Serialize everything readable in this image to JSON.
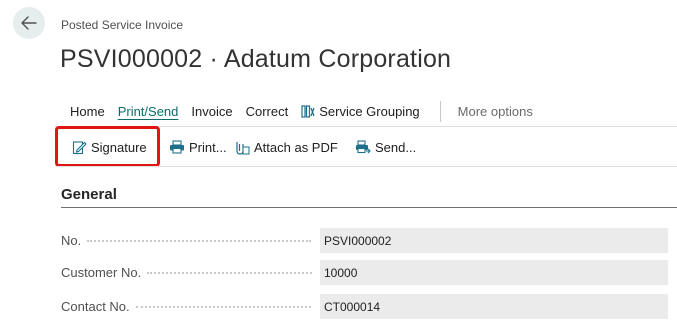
{
  "page": {
    "caption": "Posted Service Invoice",
    "title": "PSVI000002 · Adatum Corporation"
  },
  "menu": {
    "items": [
      {
        "label": "Home"
      },
      {
        "label": "Print/Send",
        "active": true
      },
      {
        "label": "Invoice"
      },
      {
        "label": "Correct"
      },
      {
        "label": "Service Grouping",
        "icon": "service-grouping-icon"
      }
    ],
    "more_options": "More options"
  },
  "actions": [
    {
      "label": "Signature",
      "icon": "signature-icon",
      "highlighted": true
    },
    {
      "label": "Print...",
      "icon": "printer-icon"
    },
    {
      "label": "Attach as PDF",
      "icon": "attach-pdf-icon"
    },
    {
      "label": "Send...",
      "icon": "send-icon"
    }
  ],
  "general": {
    "title": "General",
    "fields": [
      {
        "label": "No.",
        "value": "PSVI000002"
      },
      {
        "label": "Customer No.",
        "value": "10000"
      },
      {
        "label": "Contact No.",
        "value": "CT000014"
      }
    ]
  },
  "colors": {
    "accent": "#0d6b6b",
    "highlight": "#e01616",
    "field_bg": "#ebebeb"
  }
}
